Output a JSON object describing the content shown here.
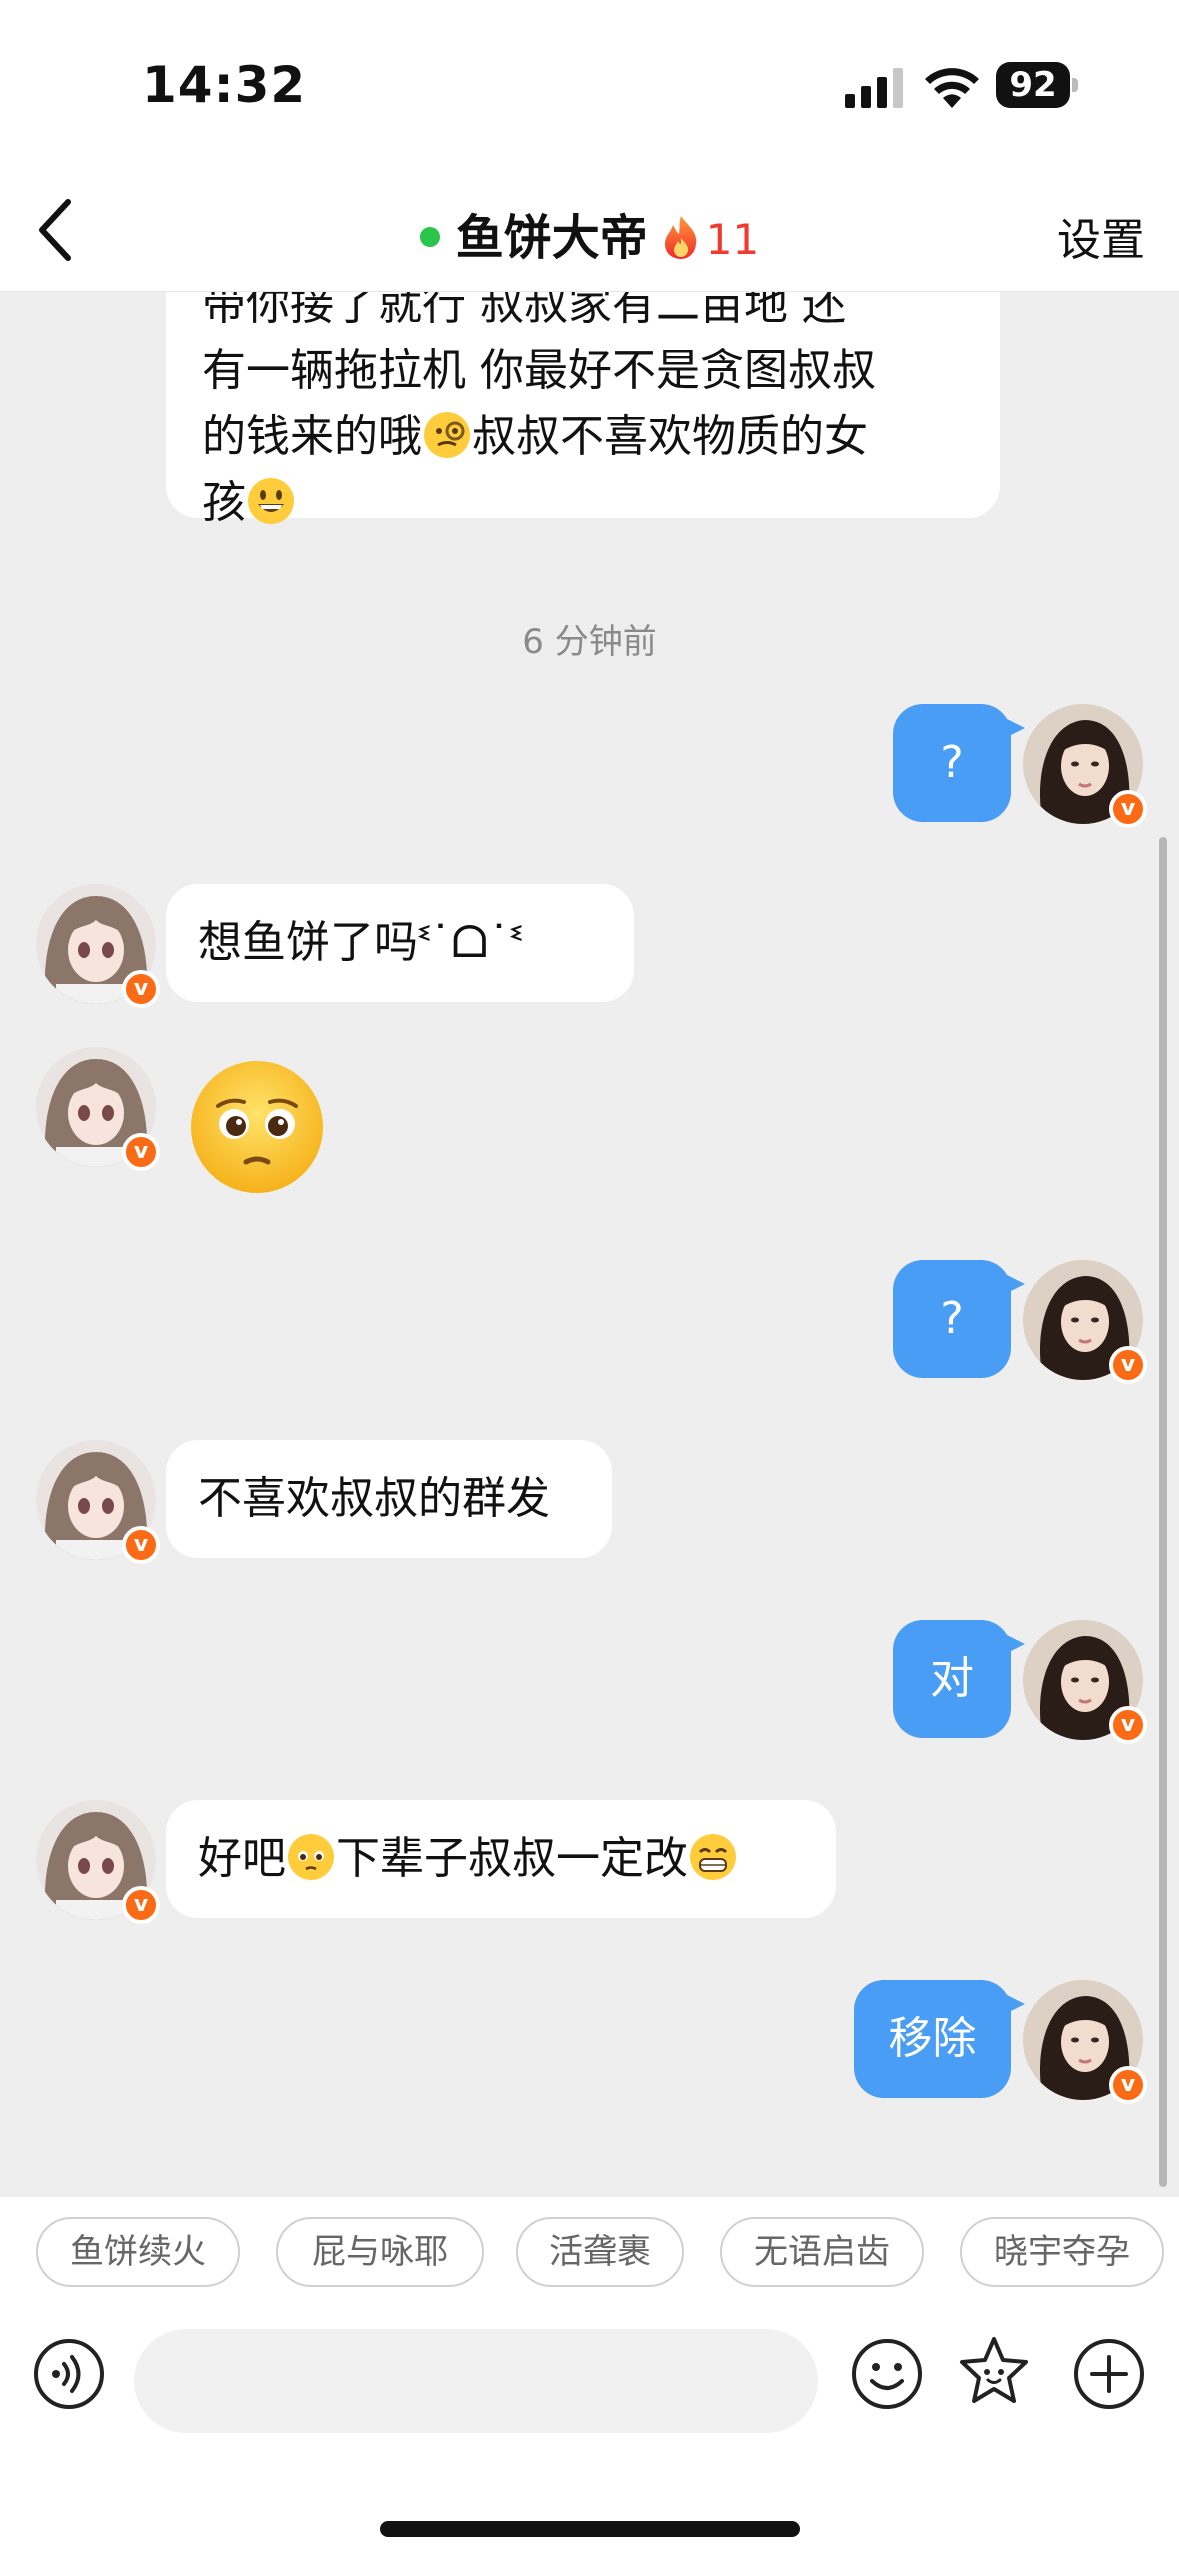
{
  "status_bar": {
    "time": "14:32",
    "battery": "92"
  },
  "nav": {
    "title": "鱼饼大帝",
    "streak": "11",
    "settings_label": "设置"
  },
  "chat": {
    "cut_off_message": {
      "line0": "带你接了就行 叔叔家有二亩地 还",
      "line1": "有一辆拖拉机 你最好不是贪图叔叔",
      "line2a": "的钱来的哦",
      "line2b": "叔叔不喜欢物质的女",
      "line3": "孩"
    },
    "timestamp": "6 分钟前",
    "messages": [
      {
        "side": "right",
        "text": "?"
      },
      {
        "side": "left",
        "text": "想鱼饼了吗ᓫ˙ᗝ˙ᓫ"
      },
      {
        "side": "left",
        "type": "emoji",
        "emoji_name": "pleading-face-emoji"
      },
      {
        "side": "right",
        "text": "?"
      },
      {
        "side": "left",
        "text": "不喜欢叔叔的群发"
      },
      {
        "side": "right",
        "text": "对"
      },
      {
        "side": "left",
        "text_a": "好吧",
        "text_b": "下辈子叔叔一定改"
      },
      {
        "side": "right",
        "text": "移除"
      }
    ]
  },
  "quick_replies": [
    "鱼饼续火",
    "屁与咏耶",
    "活聋裹",
    "无语启齿",
    "晓宇夺孕"
  ],
  "input": {
    "placeholder": ""
  },
  "colors": {
    "accent_blue": "#4a9df5",
    "online_green": "#2ac54a",
    "badge_orange": "#fb6a14",
    "streak_red": "#f03a2f"
  }
}
